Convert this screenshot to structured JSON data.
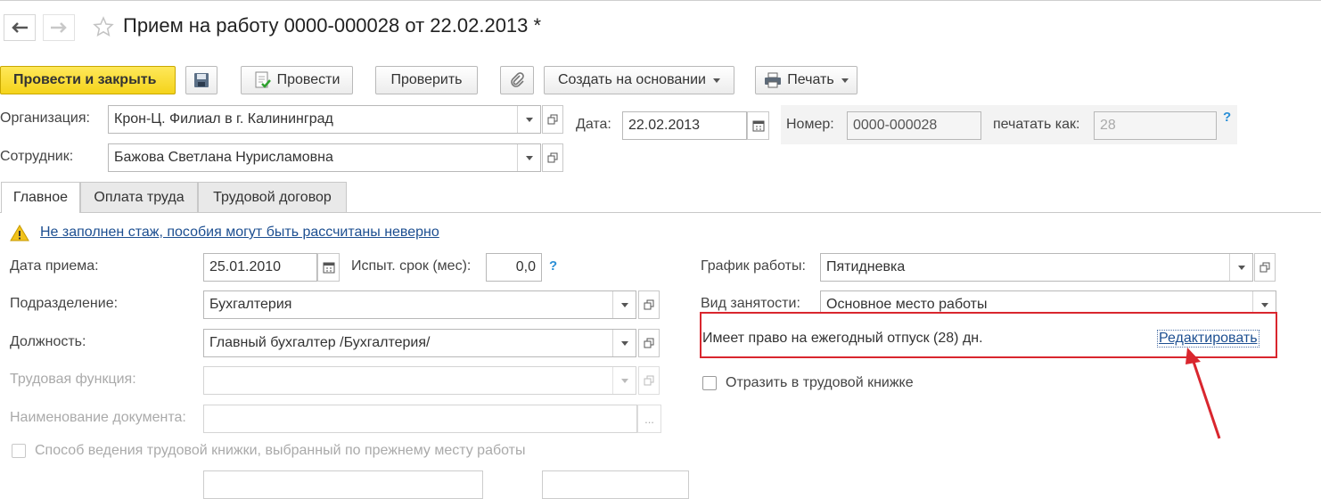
{
  "header": {
    "title": "Прием на работу 0000-000028 от 22.02.2013 *"
  },
  "toolbar": {
    "post_close": "Провести и закрыть",
    "post": "Провести",
    "check": "Проверить",
    "create_based_on": "Создать на основании",
    "print": "Печать"
  },
  "form": {
    "org_label": "Организация:",
    "org_value": "Крон-Ц. Филиал в г. Калининград",
    "emp_label": "Сотрудник:",
    "emp_value": "Бажова Светлана Нурисламовна",
    "date_label": "Дата:",
    "date_value": "22.02.2013",
    "number_label": "Номер:",
    "number_value": "0000-000028",
    "print_as_label": "печатать как:",
    "print_as_placeholder": "28",
    "help": "?"
  },
  "tabs": [
    {
      "label": "Главное"
    },
    {
      "label": "Оплата труда"
    },
    {
      "label": "Трудовой договор"
    }
  ],
  "main": {
    "warning": "Не заполнен стаж, пособия могут быть рассчитаны неверно",
    "hire_date_label": "Дата приема:",
    "hire_date_value": "25.01.2010",
    "probation_label": "Испыт. срок (мес):",
    "probation_value": "0,0",
    "dept_label": "Подразделение:",
    "dept_value": "Бухгалтерия",
    "position_label": "Должность:",
    "position_value": "Главный бухгалтер /Бухгалтерия/",
    "labor_func_label": "Трудовая функция:",
    "doc_name_label": "Наименование документа:",
    "ellipsis": "...",
    "work_book_method": "Способ ведения трудовой книжки, выбранный по прежнему месту работы",
    "schedule_label": "График работы:",
    "schedule_value": "Пятидневка",
    "employment_label": "Вид занятости:",
    "employment_value": "Основное место работы",
    "vacation_text": "Имеет право на ежегодный отпуск (28) дн.",
    "edit_link": "Редактировать",
    "reflect_label": "Отразить в трудовой книжке"
  },
  "colors": {
    "primary_button": "#f4d31b",
    "link": "#1d4f91",
    "help": "#2b8fd6",
    "highlight": "#d9262e"
  }
}
